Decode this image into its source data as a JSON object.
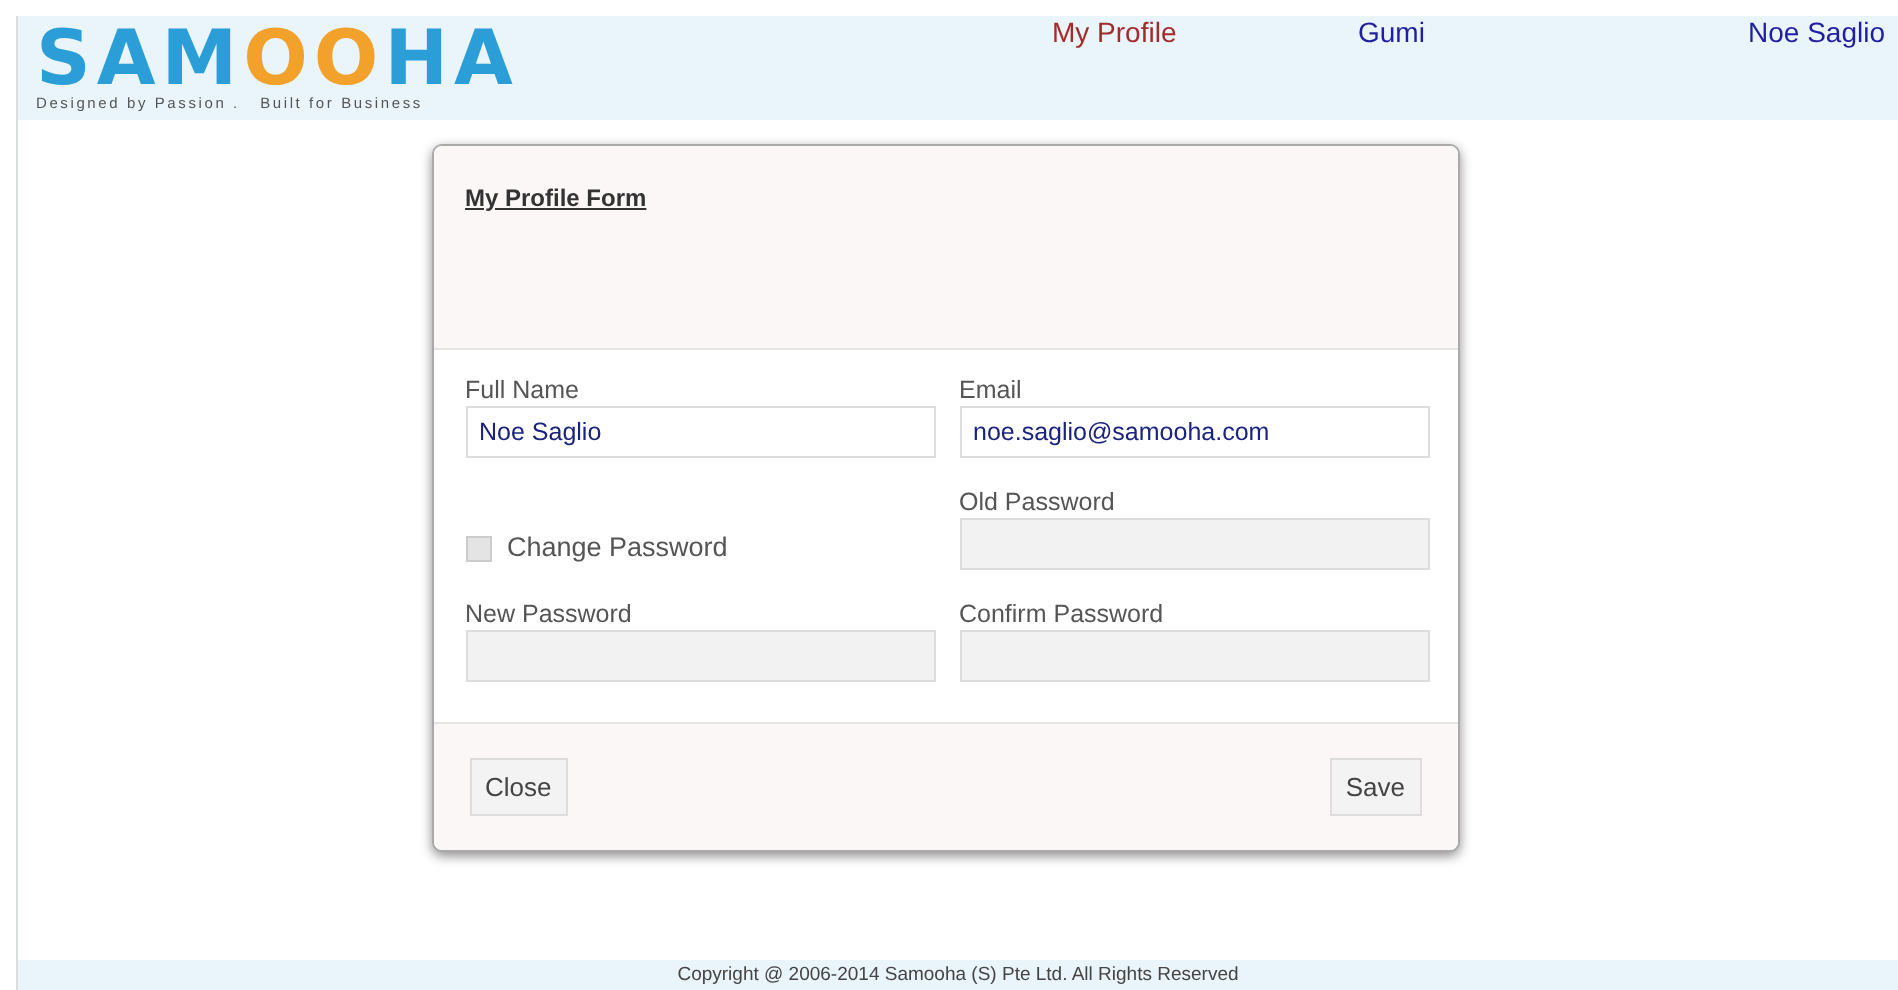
{
  "logo": {
    "parts": [
      {
        "text": "SAM",
        "color": "#2b9ed8"
      },
      {
        "text": "OO",
        "color": "#f2a22a"
      },
      {
        "text": "HA",
        "color": "#2b9ed8"
      }
    ],
    "tagline": "Designed by Passion .   Built for Business"
  },
  "nav": [
    {
      "label": "My Profile",
      "selected": true
    },
    {
      "label": "Gumi",
      "selected": false
    },
    {
      "label": "Noe Saglio",
      "selected": false
    }
  ],
  "dialog": {
    "title": "My Profile Form",
    "fields": [
      {
        "kind": "input",
        "label": "Full Name",
        "value": "Noe Saglio",
        "disabled": false
      },
      {
        "kind": "input",
        "label": "Email",
        "value": "noe.saglio@samooha.com",
        "disabled": false
      },
      {
        "kind": "checkbox",
        "label": "Change Password",
        "checked": false,
        "disabled": true
      },
      {
        "kind": "input",
        "label": "Old Password",
        "disabled": true
      },
      {
        "kind": "input",
        "label": "New Password",
        "disabled": true
      },
      {
        "kind": "input",
        "label": "Confirm Password",
        "disabled": true
      }
    ],
    "buttons": [
      "Close",
      "Save"
    ]
  },
  "footer": "Copyright @ 2006-2014 Samooha (S) Pte Ltd. All Rights Reserved"
}
